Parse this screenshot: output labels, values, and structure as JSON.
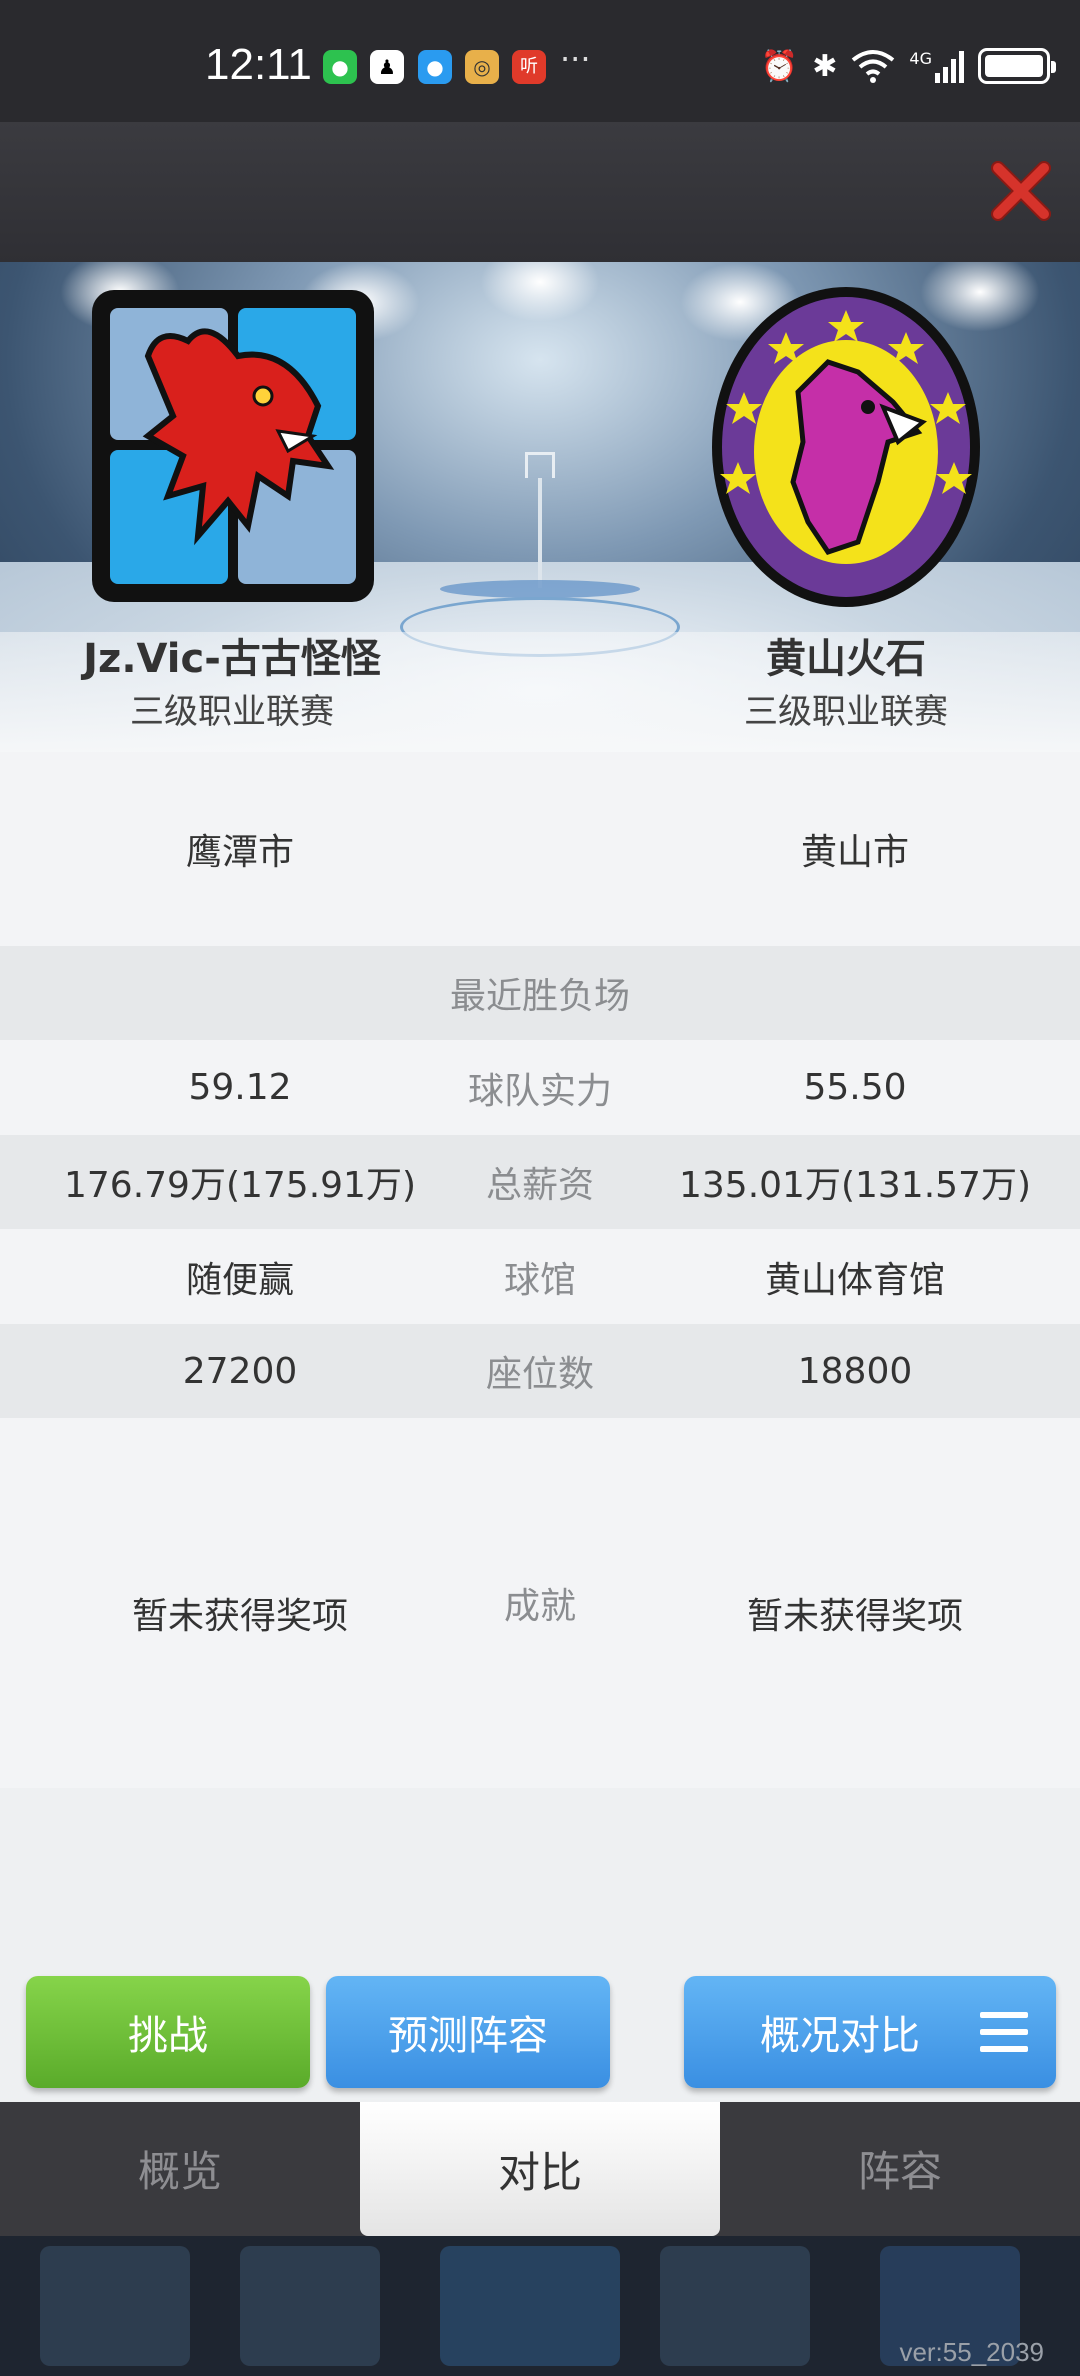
{
  "status_bar": {
    "time": "12:11",
    "more": "···",
    "icons": [
      "wechat-icon",
      "qq-icon",
      "message-icon",
      "app-icon",
      "ting-icon",
      "alarm-icon",
      "bluetooth-icon",
      "wifi-icon",
      "signal-4g-icon",
      "battery-icon"
    ],
    "network": "4G"
  },
  "header": {
    "close_icon": "close-icon"
  },
  "teams": {
    "left": {
      "name": "Jz.Vic-古古怪怪",
      "league": "三级职业联赛",
      "city": "鹰潭市"
    },
    "right": {
      "name": "黄山火石",
      "league": "三级职业联赛",
      "city": "黄山市"
    }
  },
  "rows": {
    "recent": {
      "label": "最近胜负场"
    },
    "strength": {
      "label": "球队实力",
      "left": "59.12",
      "right": "55.50"
    },
    "salary": {
      "label": "总薪资",
      "left": "176.79万(175.91万)",
      "right": "135.01万(131.57万)"
    },
    "arena": {
      "label": "球馆",
      "left": "随便赢",
      "right": "黄山体育馆"
    },
    "seats": {
      "label": "座位数",
      "left": "27200",
      "right": "18800"
    },
    "achievements": {
      "label": "成就",
      "left": "暂未获得奖项",
      "right": "暂未获得奖项"
    }
  },
  "actions": {
    "challenge": "挑战",
    "predict": "预测阵容",
    "compare": "概况对比"
  },
  "tabs": {
    "overview": "概览",
    "compare": "对比",
    "roster": "阵容"
  },
  "version": "ver:55_2039",
  "colors": {
    "green_button": "#6cc13a",
    "blue_button": "#4a9ee8",
    "close_red": "#d6332b"
  }
}
